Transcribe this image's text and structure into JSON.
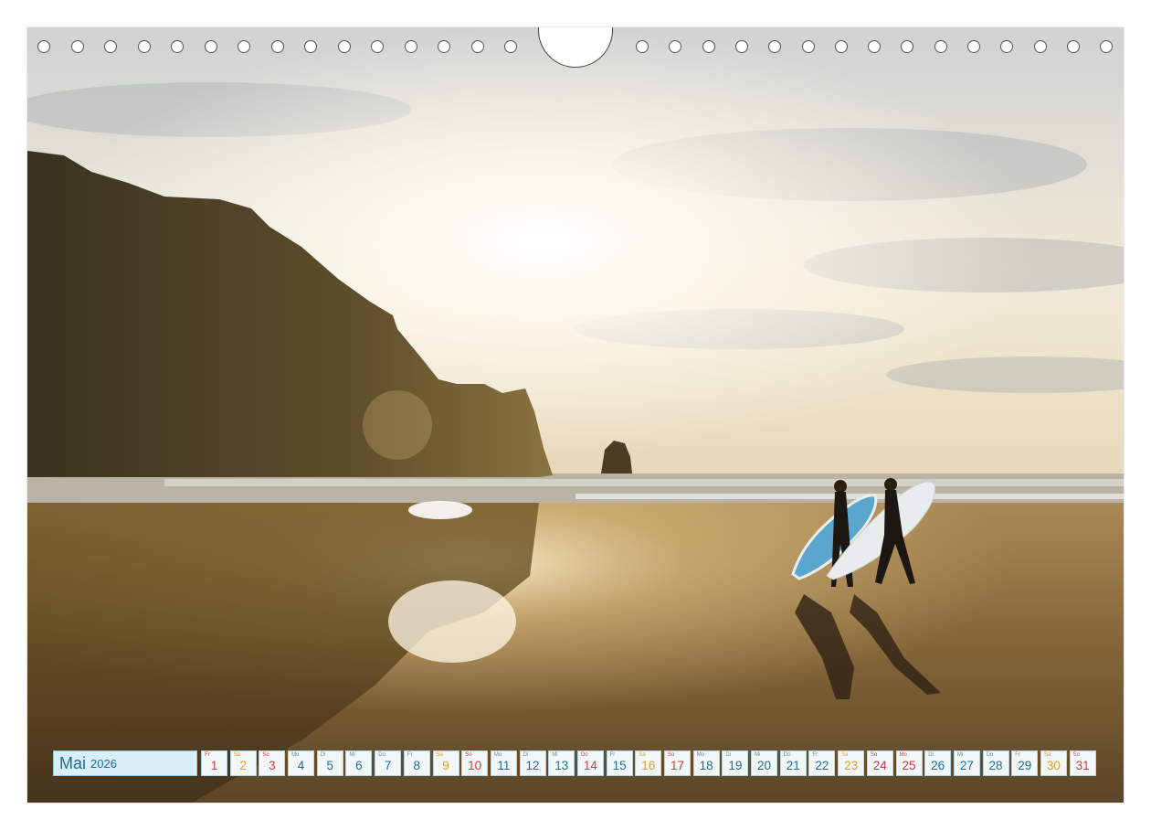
{
  "calendar": {
    "month": "Mai",
    "year": "2026",
    "days": [
      {
        "wd": "Fr",
        "n": "1",
        "kind": "sun"
      },
      {
        "wd": "Sa",
        "n": "2",
        "kind": "sat"
      },
      {
        "wd": "So",
        "n": "3",
        "kind": "sun"
      },
      {
        "wd": "Mo",
        "n": "4",
        "kind": "week"
      },
      {
        "wd": "Di",
        "n": "5",
        "kind": "week"
      },
      {
        "wd": "Mi",
        "n": "6",
        "kind": "week"
      },
      {
        "wd": "Do",
        "n": "7",
        "kind": "week"
      },
      {
        "wd": "Fr",
        "n": "8",
        "kind": "week"
      },
      {
        "wd": "Sa",
        "n": "9",
        "kind": "sat"
      },
      {
        "wd": "So",
        "n": "10",
        "kind": "sun"
      },
      {
        "wd": "Mo",
        "n": "11",
        "kind": "week"
      },
      {
        "wd": "Di",
        "n": "12",
        "kind": "week"
      },
      {
        "wd": "Mi",
        "n": "13",
        "kind": "week"
      },
      {
        "wd": "Do",
        "n": "14",
        "kind": "sun"
      },
      {
        "wd": "Fr",
        "n": "15",
        "kind": "week"
      },
      {
        "wd": "Sa",
        "n": "16",
        "kind": "sat"
      },
      {
        "wd": "So",
        "n": "17",
        "kind": "sun"
      },
      {
        "wd": "Mo",
        "n": "18",
        "kind": "week"
      },
      {
        "wd": "Di",
        "n": "19",
        "kind": "week"
      },
      {
        "wd": "Mi",
        "n": "20",
        "kind": "week"
      },
      {
        "wd": "Do",
        "n": "21",
        "kind": "week"
      },
      {
        "wd": "Fr",
        "n": "22",
        "kind": "week"
      },
      {
        "wd": "Sa",
        "n": "23",
        "kind": "sat"
      },
      {
        "wd": "So",
        "n": "24",
        "kind": "sun"
      },
      {
        "wd": "Mo",
        "n": "25",
        "kind": "sun"
      },
      {
        "wd": "Di",
        "n": "26",
        "kind": "week"
      },
      {
        "wd": "Mi",
        "n": "27",
        "kind": "week"
      },
      {
        "wd": "Do",
        "n": "28",
        "kind": "week"
      },
      {
        "wd": "Fr",
        "n": "29",
        "kind": "week"
      },
      {
        "wd": "Sa",
        "n": "30",
        "kind": "sat"
      },
      {
        "wd": "So",
        "n": "31",
        "kind": "sun"
      }
    ]
  },
  "colors": {
    "weekday": "#1f6f98",
    "saturday": "#e0a21a",
    "sunday_holiday": "#d43b3b",
    "month_box": "#d9eef7"
  },
  "photo": {
    "icons": [
      "sea-stack-rock",
      "surfer-icon",
      "surfboard-icon",
      "sun-icon"
    ]
  }
}
